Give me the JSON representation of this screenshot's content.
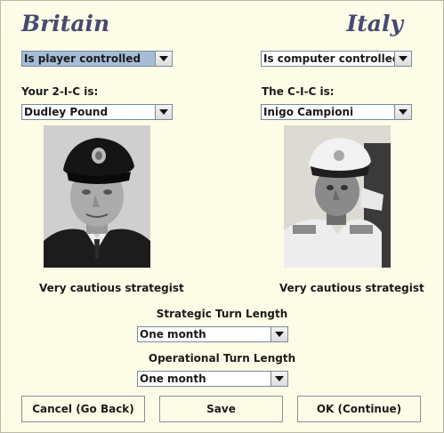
{
  "britain": {
    "title": "Britain",
    "control": "Is player controlled",
    "commander_label": "Your 2-I-C is:",
    "commander": "Dudley Pound",
    "strategist": "Very cautious strategist"
  },
  "italy": {
    "title": "Italy",
    "control": "Is computer controlled",
    "commander_label": "The C-I-C is:",
    "commander": "Inigo Campioni",
    "strategist": "Very cautious strategist"
  },
  "strategic_turn": {
    "label": "Strategic Turn Length",
    "value": "One month"
  },
  "operational_turn": {
    "label": "Operational Turn Length",
    "value": "One month"
  },
  "buttons": {
    "cancel": "Cancel (Go Back)",
    "save": "Save",
    "ok": "OK (Continue)"
  },
  "colors": {
    "background": "#fdfde7",
    "title": "#474a72",
    "selection": "#a6bdd9"
  },
  "icons": {
    "dropdown": "chevron-down-icon"
  }
}
